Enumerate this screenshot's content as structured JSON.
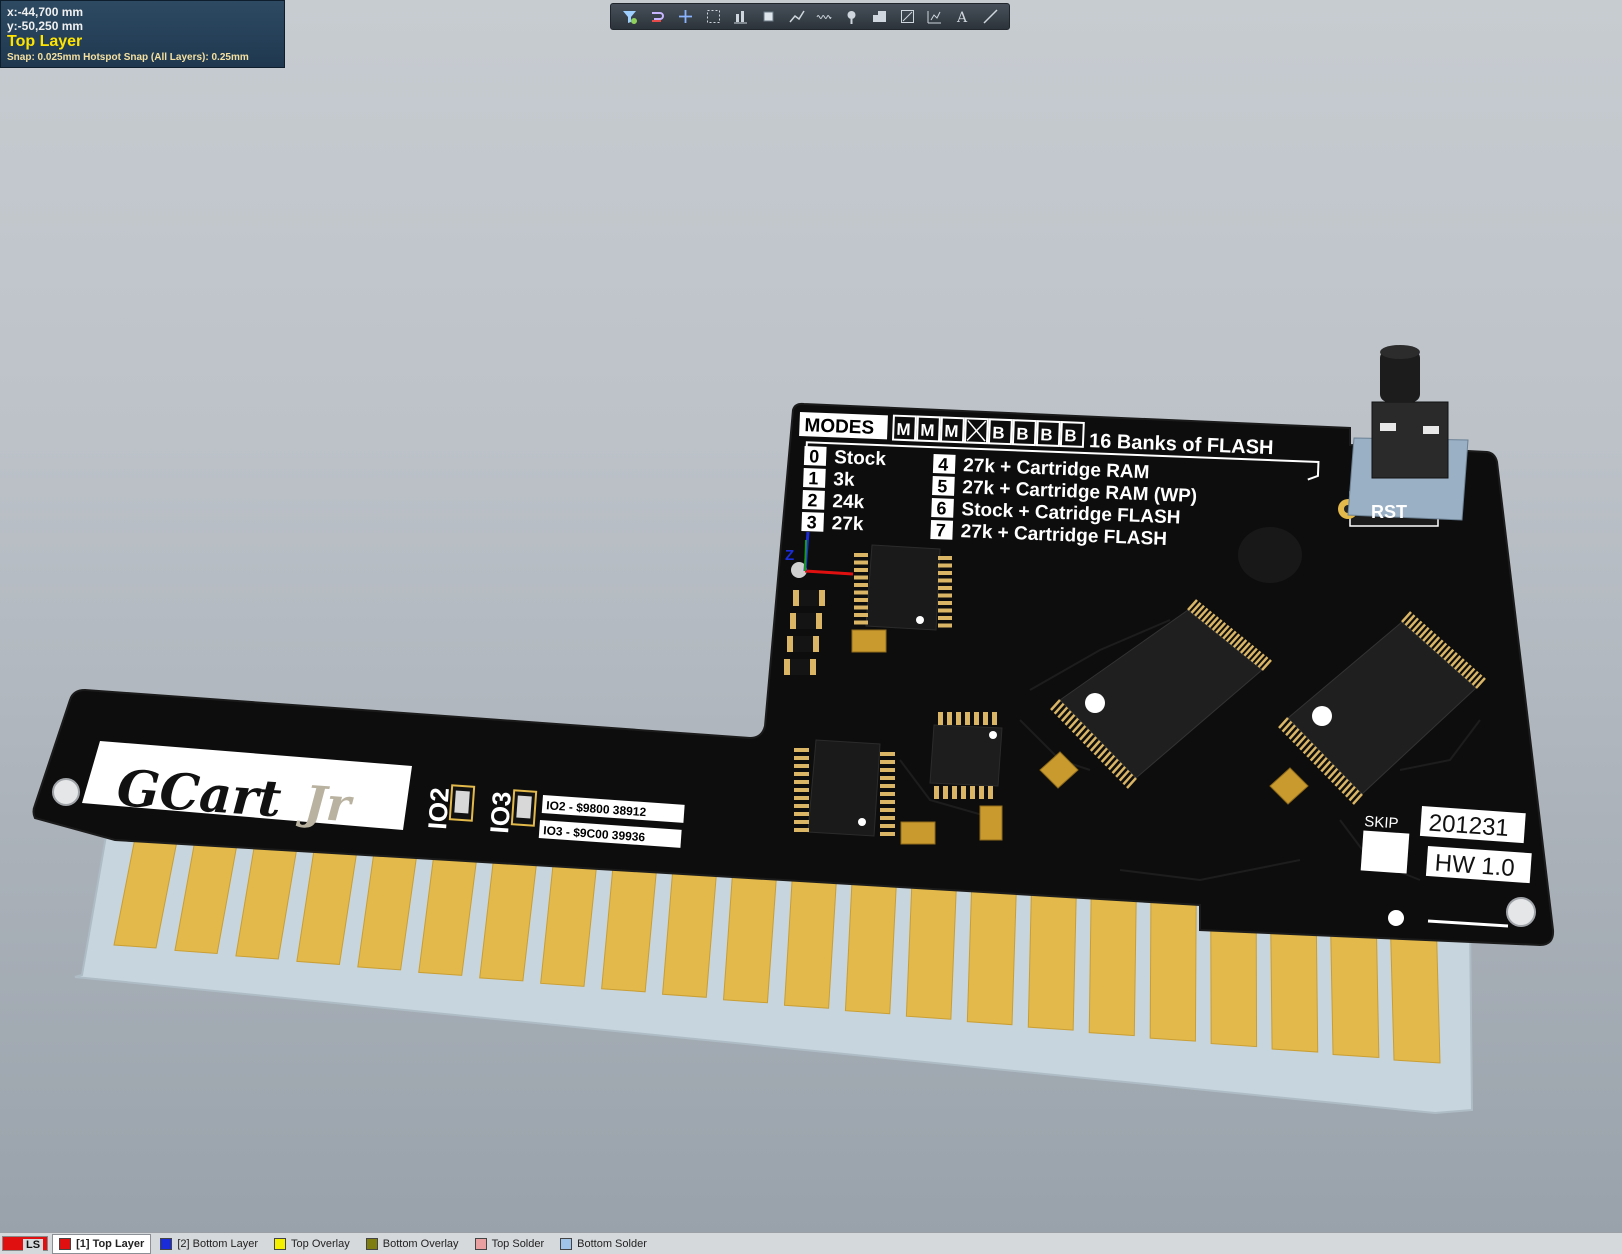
{
  "hud": {
    "x": "x:-44,700 mm",
    "y": "y:-50,250 mm",
    "layer": "Top Layer",
    "snap": "Snap: 0.025mm Hotspot Snap (All Layers): 0.25mm"
  },
  "toolbar": {
    "icons": [
      "filter-icon",
      "interactive-routing-icon",
      "add-icon",
      "select-rectangle-icon",
      "align-icon",
      "component-icon",
      "route-icon",
      "length-tuning-icon",
      "pad-via-icon",
      "polygon-icon",
      "region-icon",
      "dimension-icon",
      "text-icon",
      "line-icon"
    ]
  },
  "board": {
    "modes_title": "MODES",
    "mode_bits": [
      "M",
      "M",
      "M",
      "X",
      "B",
      "B",
      "B",
      "B"
    ],
    "banks_label": "16 Banks of FLASH",
    "modes_left": [
      {
        "num": "0",
        "label": "Stock"
      },
      {
        "num": "1",
        "label": "3k"
      },
      {
        "num": "2",
        "label": "24k"
      },
      {
        "num": "3",
        "label": "27k"
      }
    ],
    "modes_right": [
      {
        "num": "4",
        "label": "27k + Cartridge RAM"
      },
      {
        "num": "5",
        "label": "27k + Cartridge RAM (WP)"
      },
      {
        "num": "6",
        "label": "Stock + Catridge FLASH"
      },
      {
        "num": "7",
        "label": "27k + Cartridge FLASH"
      }
    ],
    "rst_label": "RST",
    "logo_main": "GCart",
    "logo_sub": "Jr",
    "io2_label": "IO2",
    "io3_label": "IO3",
    "io2_addr": "IO2 - $9800 38912",
    "io3_addr": "IO3 - $9C00 39936",
    "skip_label": "SKIP",
    "date_code": "201231",
    "hw_version": "HW 1.0",
    "axis_z": "Z",
    "finger_count": 22
  },
  "statusbar": {
    "ls_label": "LS",
    "layers": [
      {
        "label": "[1] Top Layer",
        "color": "#e01010",
        "active": true
      },
      {
        "label": "[2] Bottom Layer",
        "color": "#1a2cd8",
        "active": false
      },
      {
        "label": "Top Overlay",
        "color": "#f5f000",
        "active": false
      },
      {
        "label": "Bottom Overlay",
        "color": "#7d7d10",
        "active": false
      },
      {
        "label": "Top Solder",
        "color": "#e8a0a0",
        "active": false
      },
      {
        "label": "Bottom Solder",
        "color": "#9fc4e8",
        "active": false
      }
    ]
  },
  "colors": {
    "board": "#101010",
    "gold": "#e2b94a",
    "substrate": "#c3d2dc",
    "silkscreen": "#ffffff"
  }
}
